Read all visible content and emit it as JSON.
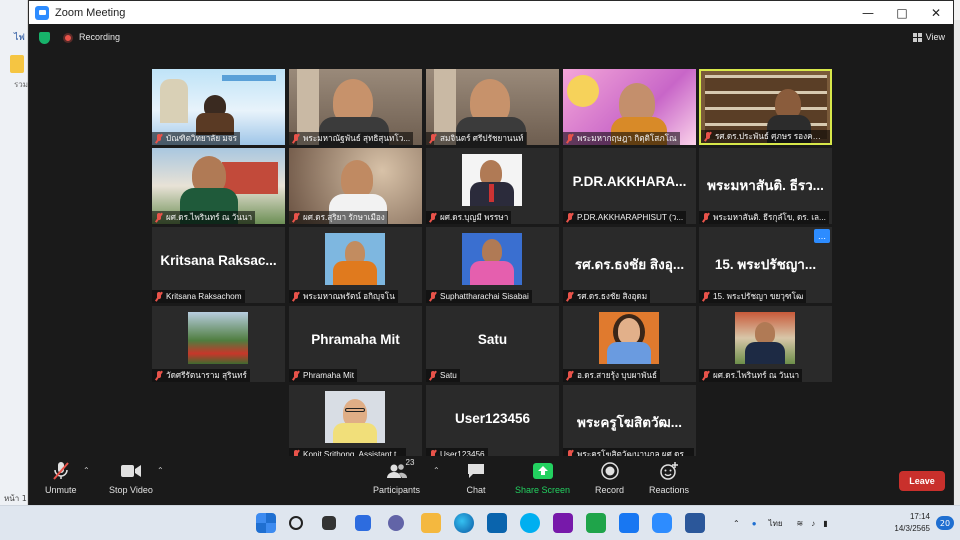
{
  "window": {
    "title": "Zoom Meeting"
  },
  "background_app": {
    "tab_text": "ไฟ",
    "side_text": "รวม",
    "status_text": "หน้า 1"
  },
  "top_bar": {
    "recording_label": "Recording",
    "view_label": "View"
  },
  "participants": [
    {
      "name": "บัณฑิตวิทยาลัย มจร",
      "big": "",
      "active": false,
      "kind": "banner"
    },
    {
      "name": "พระมหาณัฐพันธ์ สุทธิสุนทโว...",
      "big": "",
      "active": false,
      "kind": "video-room"
    },
    {
      "name": "สมจินตร์ ศรีปรัชยานนท์",
      "big": "",
      "active": false,
      "kind": "video-room"
    },
    {
      "name": "พระมหากฤษฎา กิตฺติโสภโณ",
      "big": "",
      "active": false,
      "kind": "pink-bg"
    },
    {
      "name": "รศ.ดร.ประพันธ์ ศุภษร รองคณบดี",
      "big": "",
      "active": true,
      "kind": "bookshelf"
    },
    {
      "name": "ผศ.ดร.ไพรินทร์ ณ วันนา",
      "big": "",
      "active": false,
      "kind": "campus"
    },
    {
      "name": "ผศ.ดร.สุริยา รักษาเมือง",
      "big": "",
      "active": false,
      "kind": "video-blur"
    },
    {
      "name": "ผศ.ดร.บุญมี พรรษา",
      "big": "",
      "active": false,
      "kind": "photo-suit"
    },
    {
      "name": "P.DR.AKKHARAPHISUT (ว...",
      "big": "P.DR.AKKHARA...",
      "active": false,
      "kind": "text"
    },
    {
      "name": "พระมหาสันติ. ธีรกุลํโข, ดร. เล...",
      "big": "พระมหาสันติ. ธีรว...",
      "active": false,
      "kind": "text"
    },
    {
      "name": "Kritsana Raksachom",
      "big": "Kritsana Raksac...",
      "active": false,
      "kind": "text"
    },
    {
      "name": "พระมหาณพรัตน์ อกิญฺจโน",
      "big": "",
      "active": false,
      "kind": "photo-monk"
    },
    {
      "name": "Suphattharachai Sisabai",
      "big": "",
      "active": false,
      "kind": "photo-pink"
    },
    {
      "name": "รศ.ดร.ธงชัย สิงอุดม",
      "big": "รศ.ดร.ธงชัย สิงอุ...",
      "active": false,
      "kind": "text"
    },
    {
      "name": "15. พระปรัชญา ขยวุฑโฒ",
      "big": "15. พระปรัชญา...",
      "active": false,
      "kind": "text-more"
    },
    {
      "name": "วัดศรีรัตนาราม สุรินทร์",
      "big": "",
      "active": false,
      "kind": "photo-temple"
    },
    {
      "name": "Phramaha Mit",
      "big": "Phramaha Mit",
      "active": false,
      "kind": "text"
    },
    {
      "name": "Satu",
      "big": "Satu",
      "active": false,
      "kind": "text"
    },
    {
      "name": "อ.ดร.สายรุ้ง บุบผาพันธ์",
      "big": "",
      "active": false,
      "kind": "photo-woman"
    },
    {
      "name": "ผศ.ดร.ไพรินทร์ ณ วันนา",
      "big": "",
      "active": false,
      "kind": "photo-outdoor"
    },
    {
      "name": "Konit Srithong, Assistant t...",
      "big": "",
      "active": false,
      "kind": "photo-glasses"
    },
    {
      "name": "User123456",
      "big": "User123456",
      "active": false,
      "kind": "text"
    },
    {
      "name": "พระครูโฆสิตวัฒนานุกูล,ผศ.ดร...",
      "big": "พระครูโฆสิตวัฒ...",
      "active": false,
      "kind": "text"
    }
  ],
  "toolbar": {
    "unmute": "Unmute",
    "stop_video": "Stop Video",
    "participants": "Participants",
    "participants_count": "23",
    "chat": "Chat",
    "share_screen": "Share Screen",
    "record": "Record",
    "reactions": "Reactions",
    "leave": "Leave"
  },
  "taskbar": {
    "lang": "ไทย",
    "time": "17:14",
    "date": "14/3/2565",
    "notifications": "20"
  },
  "colors": {
    "active_border": "#d8e84a",
    "leave": "#c9302c",
    "share": "#23d160",
    "zoom_blue": "#2d8cff"
  }
}
